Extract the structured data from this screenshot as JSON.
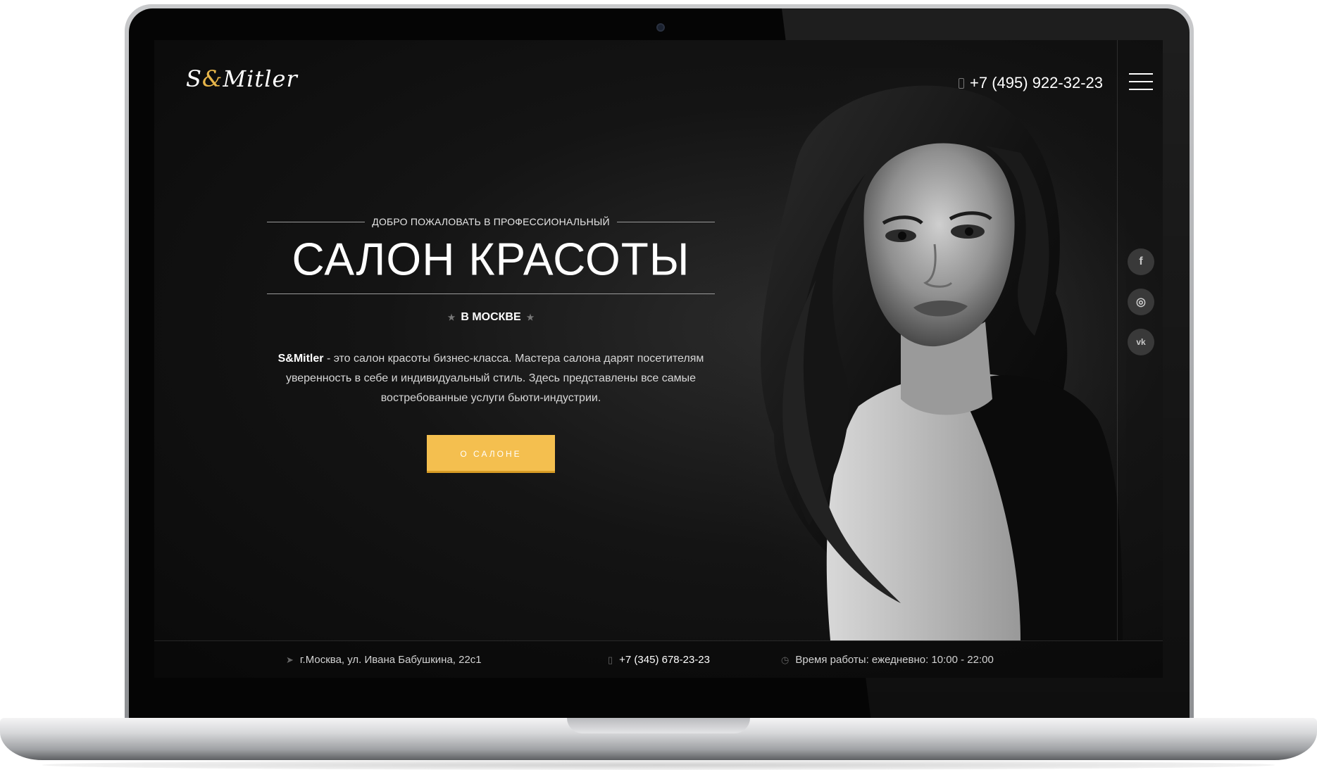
{
  "header": {
    "logo_first": "S",
    "logo_amp": "&",
    "logo_rest": "Mitler",
    "phone": "+7 (495) 922-32-23"
  },
  "hero": {
    "welcome": "ДОБРО ПОЖАЛОВАТЬ В ПРОФЕССИОНАЛЬНЫЙ",
    "title": "САЛОН КРАСОТЫ",
    "city": "В МОСКВЕ",
    "desc_brand": "S&Mitler",
    "desc_text": " - это салон красоты бизнес-класса. Мастера салона дарят посетителям уверенность в себе и индивидуальный стиль. Здесь представлены все самые востребованные услуги бьюти-индустрии.",
    "button_label": "О САЛОНЕ"
  },
  "social": {
    "facebook": "f",
    "instagram": "◎",
    "vk": "vk"
  },
  "footer": {
    "address": "г.Москва, ул. Ивана Бабушкина, 22с1",
    "phone": "+7 (345) 678-23-23",
    "hours": "Время работы: ежедневно: 10:00 - 22:00"
  },
  "colors": {
    "accent": "#f4bf4f",
    "background": "#111111"
  }
}
